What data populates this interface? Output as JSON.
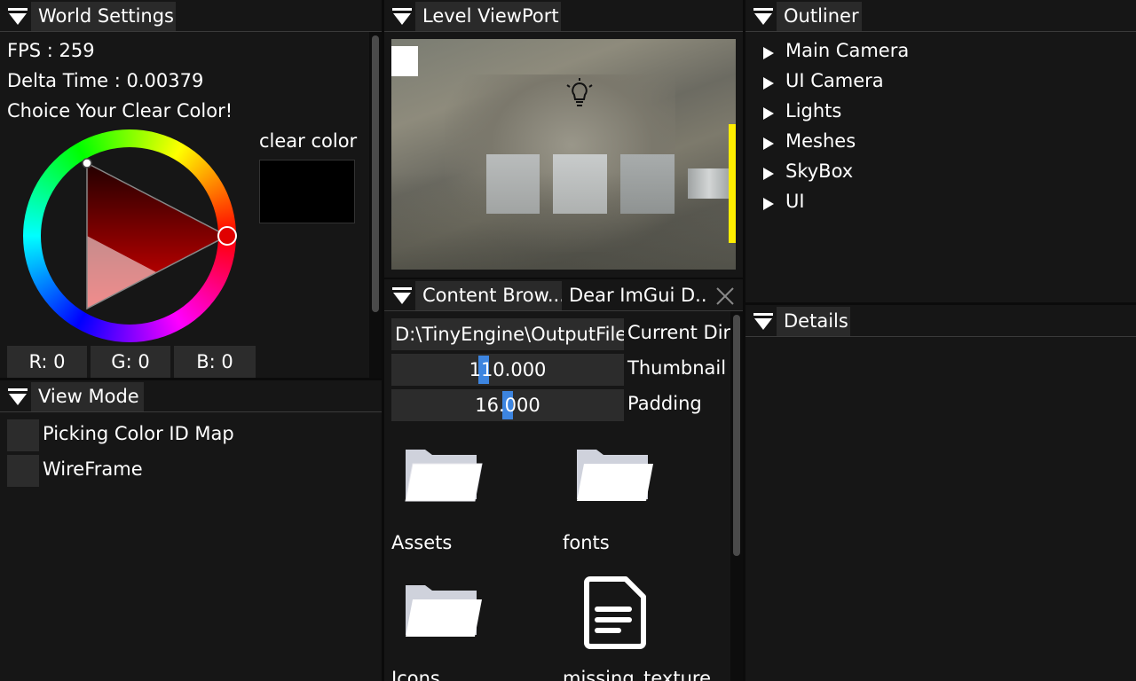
{
  "world_settings": {
    "title": "World Settings",
    "fps_label": "FPS : 259",
    "delta_label": "Delta Time : 0.00379",
    "choice_label": "Choice Your Clear Color!",
    "clear_color_label": "clear color",
    "clear_color_value": "#000000",
    "r_label": "R:  0",
    "g_label": "G:  0",
    "b_label": "B:  0"
  },
  "view_mode": {
    "title": "View Mode",
    "options": [
      "Picking Color ID Map",
      "WireFrame"
    ]
  },
  "level_viewport": {
    "title": "Level ViewPort"
  },
  "content_browser": {
    "tab_label": "Content Brow...",
    "other_tab_label": "Dear ImGui D...",
    "path_value": "D:\\TinyEngine\\OutputFile",
    "path_label": "Current Dir",
    "thumbnail_value": "110.000",
    "thumbnail_label": "Thumbnail",
    "padding_value": "16.000",
    "padding_label": "Padding",
    "items": [
      {
        "name": "Assets",
        "icon": "folder-icon"
      },
      {
        "name": "fonts",
        "icon": "folder-icon"
      },
      {
        "name": "Icons",
        "icon": "folder-icon"
      },
      {
        "name": "missing_texture",
        "icon": "file-icon"
      }
    ]
  },
  "outliner": {
    "title": "Outliner",
    "items": [
      "Main Camera",
      "UI Camera",
      "Lights",
      "Meshes",
      "SkyBox",
      "UI"
    ]
  },
  "details": {
    "title": "Details"
  },
  "colors": {
    "panel_bg": "#161616",
    "tab_bg": "#2a2a2a",
    "frame_bg": "#2c2c2c",
    "slider_grab": "#3d85e0",
    "viewport_accent": "#ffee00"
  }
}
